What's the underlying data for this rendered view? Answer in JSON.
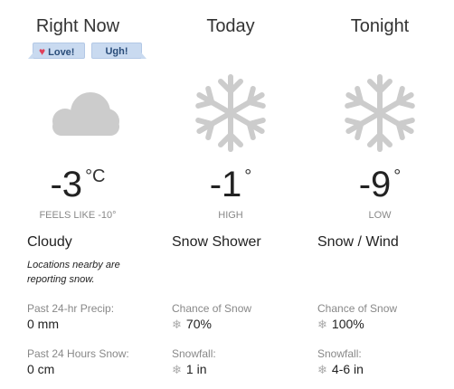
{
  "columns": [
    {
      "heading": "Right Now",
      "icon": "cloud-icon",
      "temp": "-3",
      "unit": "°C",
      "sub": "FEELS LIKE -10°",
      "condition": "Cloudy",
      "note": "Locations nearby are reporting snow.",
      "row1_label": "Past 24-hr Precip:",
      "row1_value": "0 mm",
      "row2_label": "Past 24 Hours Snow:",
      "row2_value": "0 cm"
    },
    {
      "heading": "Today",
      "icon": "snowflake-icon",
      "temp": "-1",
      "unit": "°",
      "sub": "HIGH",
      "condition": "Snow Shower",
      "row1_label": "Chance of Snow",
      "row1_value": "70%",
      "row2_label": "Snowfall:",
      "row2_value": "1 in"
    },
    {
      "heading": "Tonight",
      "icon": "snowflake-icon",
      "temp": "-9",
      "unit": "°",
      "sub": "LOW",
      "condition": "Snow / Wind",
      "row1_label": "Chance of Snow",
      "row1_value": "100%",
      "row2_label": "Snowfall:",
      "row2_value": "4-6 in"
    }
  ],
  "reactions": {
    "love_label": "Love!",
    "ugh_label": "Ugh!"
  },
  "colors": {
    "icon_gray": "#cccccc",
    "reaction_bg": "#c9daf0",
    "reaction_text": "#2a4d7a",
    "heart": "#e0405a"
  }
}
